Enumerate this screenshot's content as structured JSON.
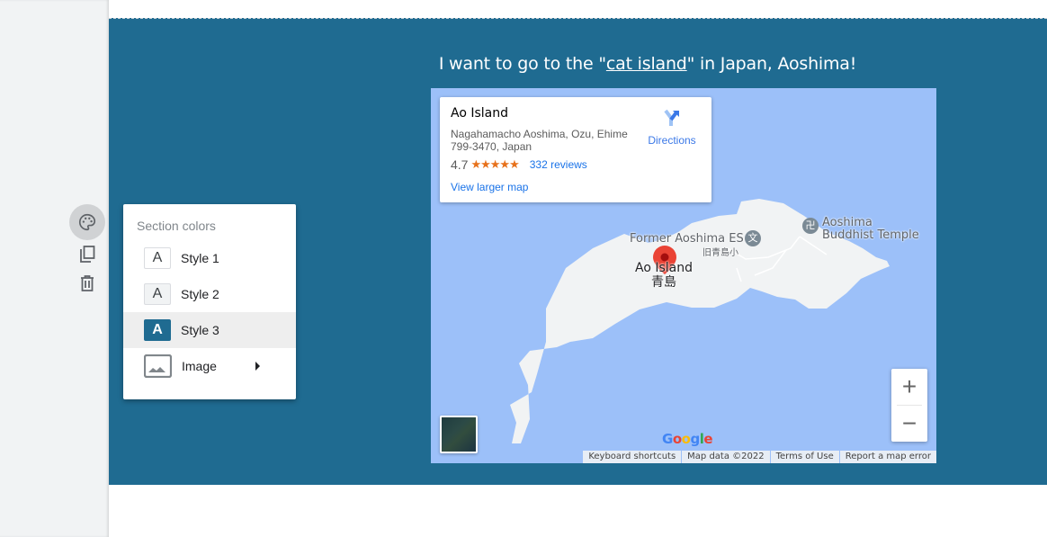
{
  "headline": {
    "before": "I want to go to the \"",
    "link": "cat island",
    "after": "\" in Japan, Aoshima!"
  },
  "section": {
    "background_color": "#1f6b91"
  },
  "tools": [
    {
      "name": "palette",
      "active": true
    },
    {
      "name": "duplicate"
    },
    {
      "name": "delete"
    }
  ],
  "menu": {
    "title": "Section colors",
    "items": [
      {
        "swatch": "A",
        "label": "Style 1",
        "selected": false
      },
      {
        "swatch": "A",
        "label": "Style 2",
        "selected": false
      },
      {
        "swatch": "A",
        "label": "Style 3",
        "selected": true
      },
      {
        "label": "Image",
        "has_submenu": true
      }
    ]
  },
  "map": {
    "card": {
      "place_name": "Ao Island",
      "address": "Nagahamacho Aoshima, Ozu, Ehime 799-3470, Japan",
      "rating": "4.7",
      "stars": "★★★★★",
      "star_value": 4.7,
      "reviews": "332 reviews",
      "larger_map": "View larger map",
      "directions": "Directions"
    },
    "labels": {
      "main_en": "Ao Island",
      "main_ja": "青島",
      "school_en": "Former Aoshima ES",
      "school_ja": "旧青島小",
      "school_icon": "文",
      "temple_line1": "Aoshima",
      "temple_line2": "Buddhist Temple",
      "temple_icon": "卍"
    },
    "zoom_in": "+",
    "zoom_out": "−",
    "google": [
      "G",
      "o",
      "o",
      "g",
      "l",
      "e"
    ],
    "attribution": [
      "Keyboard shortcuts",
      "Map data ©2022",
      "Terms of Use",
      "Report a map error"
    ]
  }
}
